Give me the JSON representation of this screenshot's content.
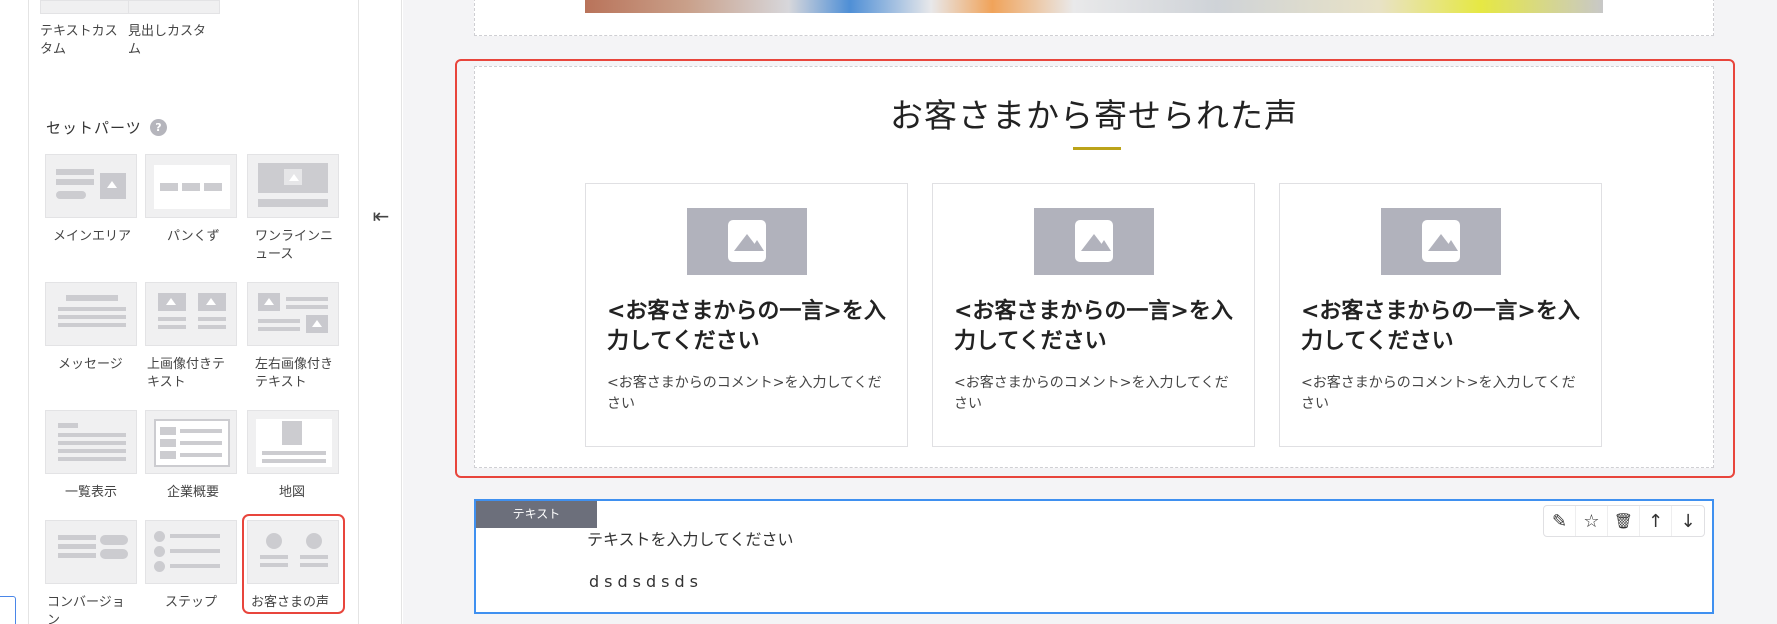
{
  "sidebar": {
    "top_parts": [
      {
        "label": "テキストカスタム"
      },
      {
        "label": "見出しカスタム"
      }
    ],
    "set_parts_title": "セットパーツ",
    "help_icon": "?",
    "set_parts": [
      {
        "label": "メインエリア",
        "icon": "main-area-thumb"
      },
      {
        "label": "パンくず",
        "icon": "breadcrumb-thumb"
      },
      {
        "label": "ワンラインニュース",
        "icon": "oneline-news-thumb"
      },
      {
        "label": "メッセージ",
        "icon": "message-thumb"
      },
      {
        "label": "上画像付きテキスト",
        "icon": "top-image-text-thumb"
      },
      {
        "label": "左右画像付きテキスト",
        "icon": "side-image-text-thumb"
      },
      {
        "label": "一覧表示",
        "icon": "list-thumb"
      },
      {
        "label": "企業概要",
        "icon": "company-thumb"
      },
      {
        "label": "地図",
        "icon": "map-thumb"
      },
      {
        "label": "コンバージョン",
        "icon": "conversion-thumb"
      },
      {
        "label": "ステップ",
        "icon": "step-thumb"
      },
      {
        "label": "お客さまの声",
        "icon": "customer-voice-thumb",
        "selected": true
      }
    ]
  },
  "collapse_icon": "⇤",
  "canvas": {
    "voice_section": {
      "title": "お客さまから寄せられた声",
      "cards": [
        {
          "heading": "<お客さまからの一言>を入力してください",
          "body": "<お客さまからのコメント>を入力してください"
        },
        {
          "heading": "<お客さまからの一言>を入力してください",
          "body": "<お客さまからのコメント>を入力してください"
        },
        {
          "heading": "<お客さまからの一言>を入力してください",
          "body": "<お客さまからのコメント>を入力してください"
        }
      ]
    },
    "text_block": {
      "tag": "テキスト",
      "placeholder": "テキストを入力してください",
      "value": "dsdsdsds",
      "toolbar": [
        {
          "icon": "pencil-icon",
          "glyph": "✎"
        },
        {
          "icon": "star-icon",
          "glyph": "☆"
        },
        {
          "icon": "trash-icon",
          "glyph": "🗑"
        },
        {
          "icon": "arrow-up-icon",
          "glyph": "↑"
        },
        {
          "icon": "arrow-down-icon",
          "glyph": "↓"
        }
      ]
    }
  },
  "colors": {
    "selection_red": "#e8453c",
    "active_blue": "#3f90f0",
    "title_accent": "#bba319",
    "placeholder_gray": "#b1b2bc"
  }
}
